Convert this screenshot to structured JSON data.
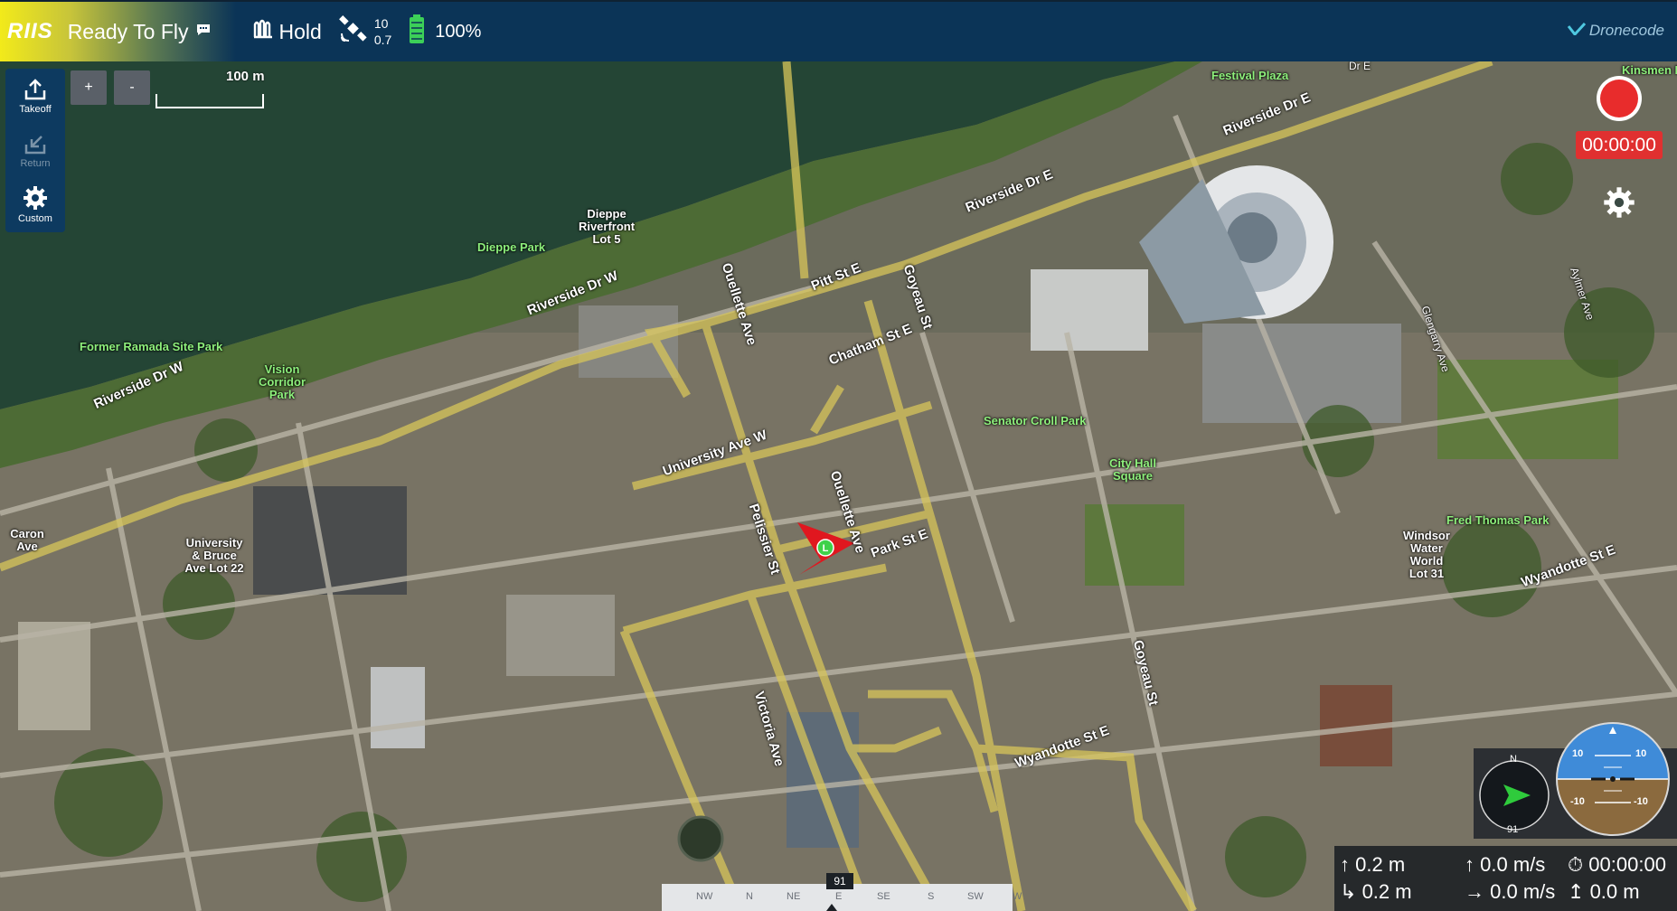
{
  "toolbar": {
    "logo": "RIIS",
    "status": "Ready To Fly",
    "mode": "Hold",
    "gps_count": "10",
    "gps_hdop": "0.7",
    "battery": "100%",
    "brand": "Dronecode"
  },
  "tools": {
    "takeoff": "Takeoff",
    "return": "Return",
    "custom": "Custom"
  },
  "map": {
    "zoom_in": "+",
    "zoom_out": "-",
    "scale": "100 m",
    "labels": {
      "festival_plaza": "Festival Plaza",
      "kinsmen_park": "Kinsmen Par",
      "dieppe_park": "Dieppe Park",
      "dieppe_riverfront": "Dieppe Riverfront Lot 5",
      "former_ramada": "Former Ramada Site Park",
      "vision_corridor": "Vision Corridor Park",
      "senator_croll": "Senator Croll Park",
      "city_hall_square": "City Hall Square",
      "fred_thomas": "Fred Thomas Park",
      "windsor_water": "Windsor Water World Lot 31",
      "university_bruce": "University & Bruce Ave Lot 22",
      "caron_ave": "Caron Ave"
    },
    "streets": {
      "riverside_e": "Riverside Dr E",
      "riverside_e2": "Riverside Dr E",
      "riverside_w": "Riverside Dr W",
      "riverside_w2": "Riverside Dr W",
      "pitt_e": "Pitt St E",
      "chatham_e": "Chatham St E",
      "ouellette": "Ouellette Ave",
      "ouellette2": "Ouellette Ave",
      "goyeau": "Goyeau St",
      "goyeau2": "Goyeau St",
      "university_w": "University Ave W",
      "pelissier": "Pelissier St",
      "park_e": "Park St E",
      "victoria": "Victoria Ave",
      "wyandotte": "Wyandotte St E",
      "wyandotte2": "Wyandotte St E",
      "glengarry": "Glengarry Ave",
      "aylmer": "Aylmer Ave",
      "dr_e": "Dr E"
    }
  },
  "recorder": {
    "timer": "00:00:00"
  },
  "instruments": {
    "compass_n": "N",
    "compass_heading": "91",
    "attitude_up_left": "10",
    "attitude_up_right": "10",
    "attitude_down_left": "-10",
    "attitude_down_right": "-10"
  },
  "telemetry": {
    "altitude_rel": "0.2 m",
    "altitude_amsl": "0.2 m",
    "vertical_speed": "0.0 m/s",
    "ground_speed": "0.0 m/s",
    "flight_time": "00:00:00",
    "distance": "0.0 m"
  },
  "heading_bar": {
    "labels": [
      "NW",
      "N",
      "NE",
      "E",
      "SE",
      "S",
      "SW",
      "W"
    ],
    "value": "91"
  }
}
